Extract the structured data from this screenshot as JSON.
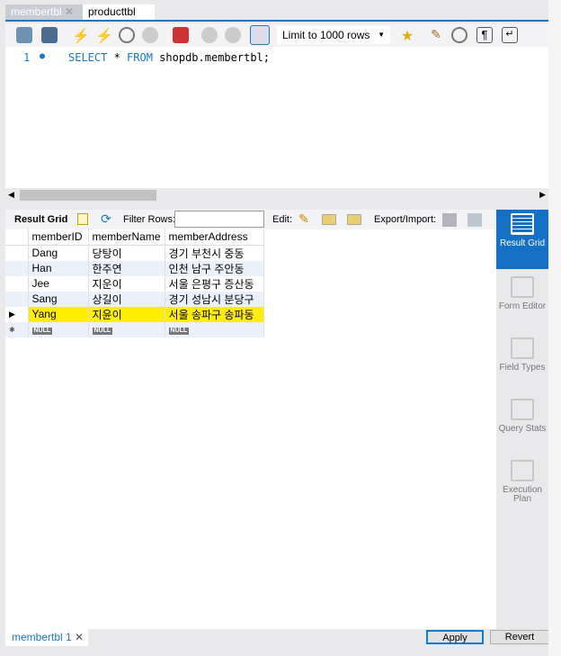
{
  "tabs": [
    {
      "label": "membertbl",
      "active": true
    },
    {
      "label": "producttbl",
      "active": false
    }
  ],
  "toolbar": {
    "limit": "Limit to 1000 rows",
    "icons": [
      "open-folder-icon",
      "save-icon",
      "execute-icon",
      "execute-current-icon",
      "explain-icon",
      "stop-icon",
      "toggle-error-icon",
      "commit-icon",
      "rollback-icon",
      "autocommit-icon",
      "bookmark-icon",
      "beautify-icon",
      "find-icon",
      "invisible-chars-icon",
      "wrap-icon"
    ]
  },
  "editor": {
    "line": "1",
    "kw1": "SELECT",
    "star": " * ",
    "kw2": "FROM",
    "rest": " shopdb.membertbl;"
  },
  "result_toolbar": {
    "result_grid": "Result Grid",
    "filter": "Filter Rows:",
    "edit": "Edit:",
    "export": "Export/Import:"
  },
  "grid": {
    "columns": [
      "memberID",
      "memberName",
      "memberAddress"
    ],
    "rows": [
      [
        "Dang",
        "당탕이",
        "경기 부천시 중동"
      ],
      [
        "Han",
        "한주연",
        "인천 남구 주안동"
      ],
      [
        "Jee",
        "지운이",
        "서울 은평구 증산동"
      ],
      [
        "Sang",
        "상길이",
        "경기 성남시 분당구"
      ],
      [
        "Yang",
        "지윤이",
        "서울 송파구 송파동"
      ]
    ],
    "null": "NULL"
  },
  "side": [
    {
      "label": "Result Grid",
      "active": true
    },
    {
      "label": "Form Editor"
    },
    {
      "label": "Field Types"
    },
    {
      "label": "Query Stats"
    },
    {
      "label": "Execution Plan"
    }
  ],
  "bottom": {
    "tab": "membertbl 1",
    "apply": "Apply",
    "revert": "Revert"
  },
  "colors": {
    "accent": "#1979ca",
    "highlight": "#ffee00"
  }
}
